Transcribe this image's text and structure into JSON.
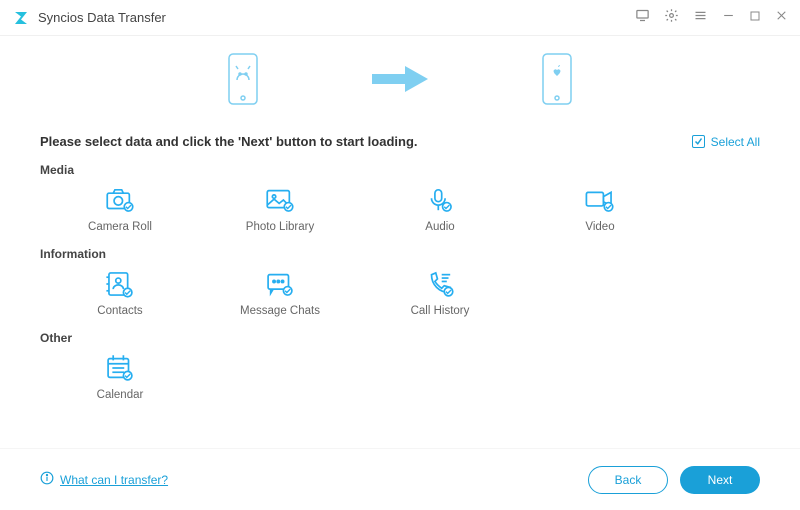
{
  "app": {
    "title": "Syncios Data Transfer"
  },
  "instruction": "Please select data and click the 'Next' button to start loading.",
  "select_all": "Select All",
  "sections": {
    "media": {
      "title": "Media",
      "items": {
        "camera_roll": "Camera Roll",
        "photo_library": "Photo Library",
        "audio": "Audio",
        "video": "Video"
      }
    },
    "information": {
      "title": "Information",
      "items": {
        "contacts": "Contacts",
        "message_chats": "Message Chats",
        "call_history": "Call History"
      }
    },
    "other": {
      "title": "Other",
      "items": {
        "calendar": "Calendar"
      }
    }
  },
  "footer": {
    "help": "What can I transfer?",
    "back": "Back",
    "next": "Next"
  }
}
